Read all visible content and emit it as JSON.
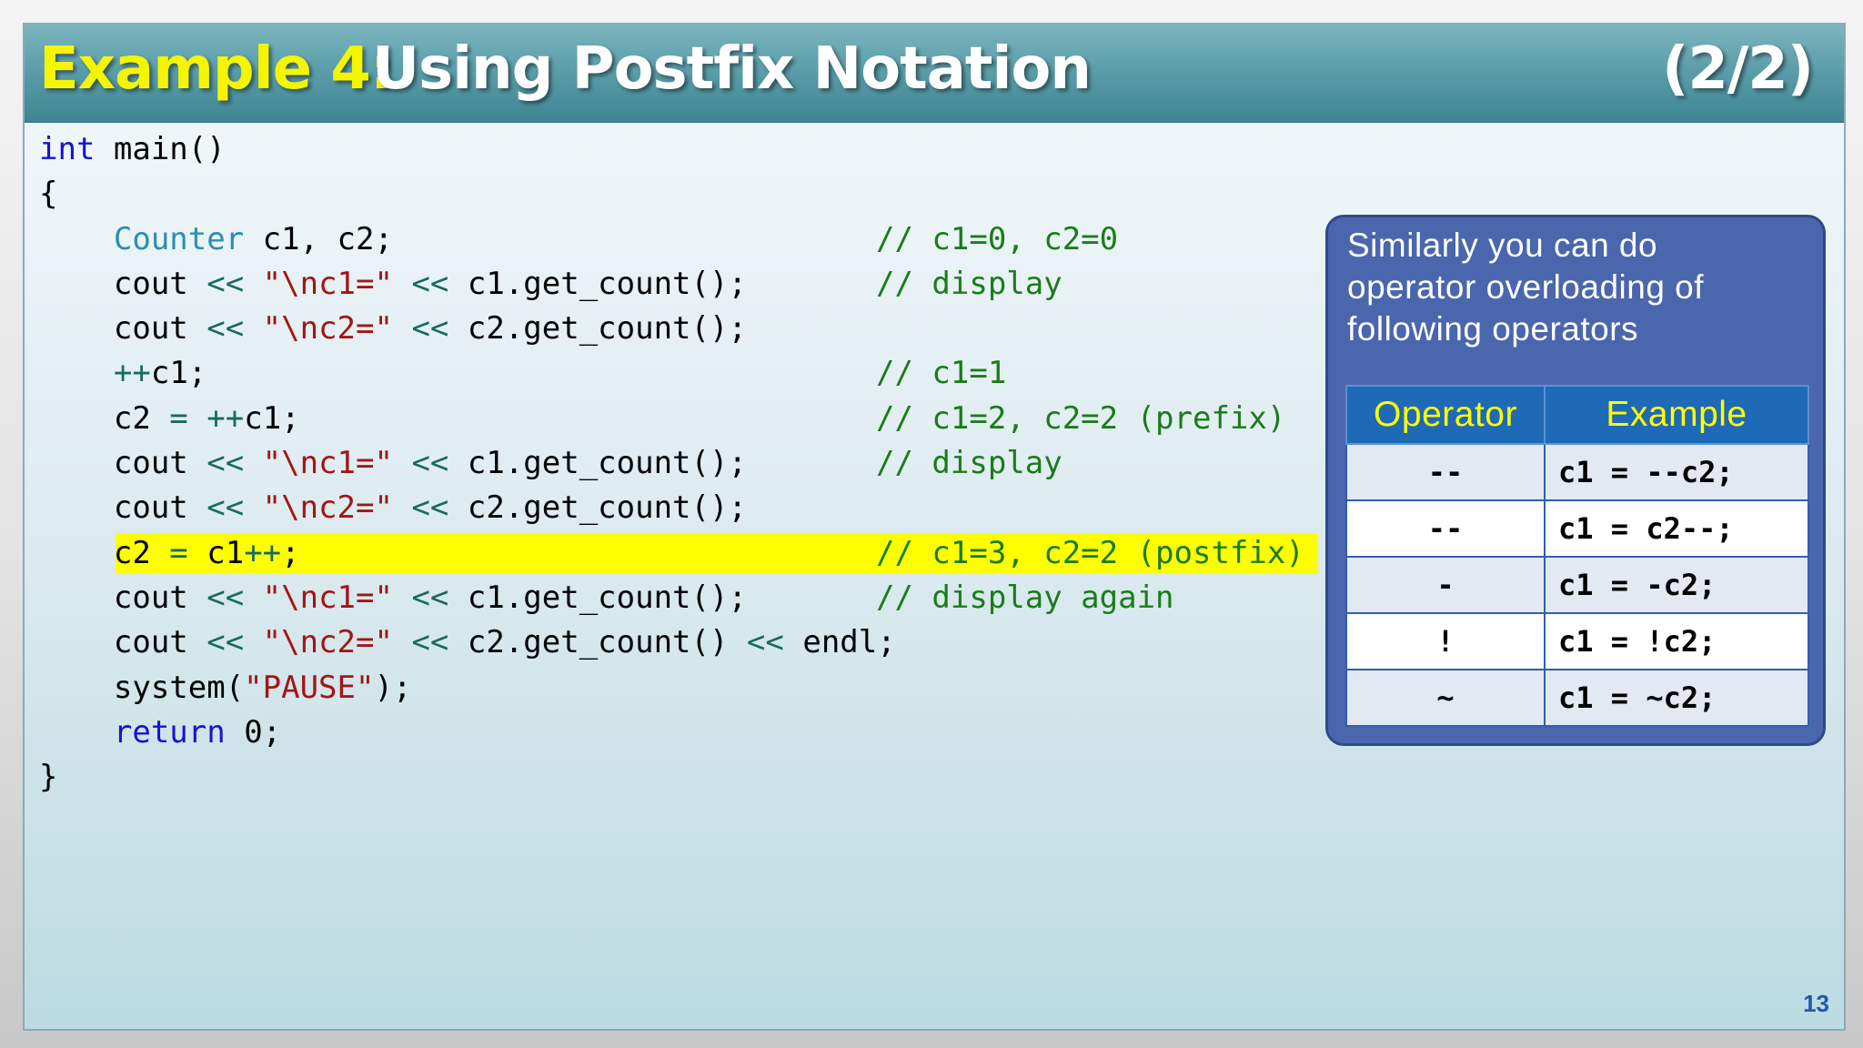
{
  "title": {
    "prefix": "Example 4:",
    "main": "Using Postfix Notation",
    "counter": "(2/2)"
  },
  "code": [
    {
      "code": [
        {
          "t": "int",
          "c": "kw"
        },
        {
          "t": " main()",
          "c": "nm"
        }
      ],
      "comment": ""
    },
    {
      "code": [
        {
          "t": "{",
          "c": "nm"
        }
      ],
      "comment": ""
    },
    {
      "code": [
        {
          "t": "    ",
          "c": "nm"
        },
        {
          "t": "Counter",
          "c": "ty"
        },
        {
          "t": " c1, c2;",
          "c": "nm"
        }
      ],
      "comment": "// c1=0, c2=0"
    },
    {
      "code": [
        {
          "t": "    cout ",
          "c": "nm"
        },
        {
          "t": "<<",
          "c": "op"
        },
        {
          "t": " ",
          "c": "nm"
        },
        {
          "t": "\"\\nc1=\"",
          "c": "st"
        },
        {
          "t": " ",
          "c": "nm"
        },
        {
          "t": "<<",
          "c": "op"
        },
        {
          "t": " c1.get_count();",
          "c": "nm"
        }
      ],
      "comment": "// display"
    },
    {
      "code": [
        {
          "t": "    cout ",
          "c": "nm"
        },
        {
          "t": "<<",
          "c": "op"
        },
        {
          "t": " ",
          "c": "nm"
        },
        {
          "t": "\"\\nc2=\"",
          "c": "st"
        },
        {
          "t": " ",
          "c": "nm"
        },
        {
          "t": "<<",
          "c": "op"
        },
        {
          "t": " c2.get_count();",
          "c": "nm"
        }
      ],
      "comment": ""
    },
    {
      "code": [
        {
          "t": "    ",
          "c": "nm"
        },
        {
          "t": "++",
          "c": "op"
        },
        {
          "t": "c1;",
          "c": "nm"
        }
      ],
      "comment": "// c1=1"
    },
    {
      "code": [
        {
          "t": "    c2 ",
          "c": "nm"
        },
        {
          "t": "=",
          "c": "op"
        },
        {
          "t": " ",
          "c": "nm"
        },
        {
          "t": "++",
          "c": "op"
        },
        {
          "t": "c1;",
          "c": "nm"
        }
      ],
      "comment": "// c1=2, c2=2 (prefix)"
    },
    {
      "code": [
        {
          "t": "    cout ",
          "c": "nm"
        },
        {
          "t": "<<",
          "c": "op"
        },
        {
          "t": " ",
          "c": "nm"
        },
        {
          "t": "\"\\nc1=\"",
          "c": "st"
        },
        {
          "t": " ",
          "c": "nm"
        },
        {
          "t": "<<",
          "c": "op"
        },
        {
          "t": " c1.get_count();",
          "c": "nm"
        }
      ],
      "comment": "// display"
    },
    {
      "code": [
        {
          "t": "    cout ",
          "c": "nm"
        },
        {
          "t": "<<",
          "c": "op"
        },
        {
          "t": " ",
          "c": "nm"
        },
        {
          "t": "\"\\nc2=\"",
          "c": "st"
        },
        {
          "t": " ",
          "c": "nm"
        },
        {
          "t": "<<",
          "c": "op"
        },
        {
          "t": " c2.get_count();",
          "c": "nm"
        }
      ],
      "comment": ""
    },
    {
      "code": [
        {
          "t": "    c2 ",
          "c": "nm"
        },
        {
          "t": "=",
          "c": "op"
        },
        {
          "t": " c1",
          "c": "nm"
        },
        {
          "t": "++",
          "c": "op"
        },
        {
          "t": ";",
          "c": "nm"
        }
      ],
      "comment": "// c1=3, c2=2 (postfix)",
      "highlight": true
    },
    {
      "code": [
        {
          "t": "    cout ",
          "c": "nm"
        },
        {
          "t": "<<",
          "c": "op"
        },
        {
          "t": " ",
          "c": "nm"
        },
        {
          "t": "\"\\nc1=\"",
          "c": "st"
        },
        {
          "t": " ",
          "c": "nm"
        },
        {
          "t": "<<",
          "c": "op"
        },
        {
          "t": " c1.get_count();",
          "c": "nm"
        }
      ],
      "comment": "// display again"
    },
    {
      "code": [
        {
          "t": "    cout ",
          "c": "nm"
        },
        {
          "t": "<<",
          "c": "op"
        },
        {
          "t": " ",
          "c": "nm"
        },
        {
          "t": "\"\\nc2=\"",
          "c": "st"
        },
        {
          "t": " ",
          "c": "nm"
        },
        {
          "t": "<<",
          "c": "op"
        },
        {
          "t": " c2.get_count() ",
          "c": "nm"
        },
        {
          "t": "<<",
          "c": "op"
        },
        {
          "t": " endl;",
          "c": "nm"
        }
      ],
      "comment": ""
    },
    {
      "code": [
        {
          "t": "    system(",
          "c": "nm"
        },
        {
          "t": "\"PAUSE\"",
          "c": "st"
        },
        {
          "t": ");",
          "c": "nm"
        }
      ],
      "comment": ""
    },
    {
      "code": [
        {
          "t": "    ",
          "c": "nm"
        },
        {
          "t": "return",
          "c": "kw"
        },
        {
          "t": " 0;",
          "c": "nm"
        }
      ],
      "comment": ""
    },
    {
      "code": [
        {
          "t": "}",
          "c": "nm"
        }
      ],
      "comment": ""
    }
  ],
  "info_box": {
    "text": "Similarly you can do\noperator overloading  of\nfollowing operators",
    "headers": [
      "Operator",
      "Example"
    ],
    "rows": [
      {
        "operator": "--",
        "example": "c1 = --c2;"
      },
      {
        "operator": "--",
        "example": "c1 = c2--;"
      },
      {
        "operator": "-",
        "example": "c1 = -c2;"
      },
      {
        "operator": "!",
        "example": "c1 = !c2;"
      },
      {
        "operator": "~",
        "example": "c1 = ~c2;"
      }
    ]
  },
  "page_number": "13",
  "colors": {
    "title_accent": "#f5f500",
    "keyword": "#1414d2",
    "type": "#2b8fae",
    "string": "#a31515",
    "comment": "#1a7c1a",
    "highlight": "#ffff00",
    "box": "#4a66ad",
    "table_header": "#1f6ab7"
  }
}
